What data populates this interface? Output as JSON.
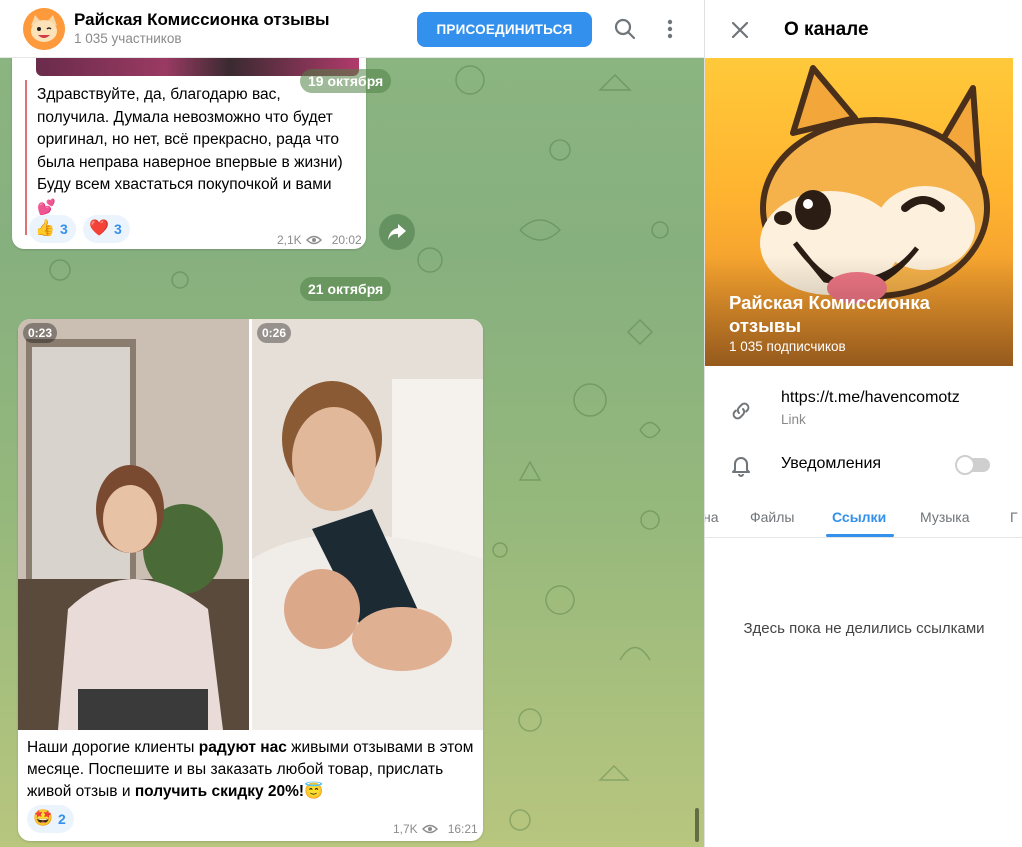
{
  "chat": {
    "title": "Райская Комиссионка отзывы",
    "subtitle": "1 035 участников",
    "join_label": "ПРИСОЕДИНИТЬСЯ"
  },
  "messages": [
    {
      "text_lines": [
        "Здравствуйте, да, благодарю вас,",
        "получила. Думала невозможно что будет",
        "оригинал, но нет, всё прекрасно, рада что",
        "была неправа наверное впервые в жизни)",
        "Буду всем хвастаться покупочкой и вами"
      ],
      "emoji": "💕",
      "reactions": [
        {
          "emoji": "👍",
          "count": "3"
        },
        {
          "emoji": "❤️",
          "count": "3"
        }
      ],
      "views": "2,1K",
      "time": "20:02"
    },
    {
      "videos": [
        {
          "duration": "0:23"
        },
        {
          "duration": "0:26"
        }
      ],
      "text_parts": [
        {
          "t": "Наши дорогие клиенты ",
          "b": false
        },
        {
          "t": "радуют нас",
          "b": true
        },
        {
          "t": " живыми отзывами в этом месяце. Поспешите и вы заказать любой товар, прислать живой отзыв и ",
          "b": false
        },
        {
          "t": "получить скидку 20%!",
          "b": true
        },
        {
          "t": "😇",
          "b": false
        }
      ],
      "reactions": [
        {
          "emoji": "🤩",
          "count": "2"
        }
      ],
      "views": "1,7K",
      "time": "16:21"
    }
  ],
  "dates": {
    "first": "19 октября",
    "second": "21 октября"
  },
  "info": {
    "title": "О канале",
    "channel_name": "Райская Комиссионка отзывы",
    "subscribers": "1 035 подписчиков",
    "link": "https://t.me/havencomotz",
    "link_caption": "Link",
    "notifications_label": "Уведомления",
    "notifications_on": false,
    "tabs": [
      {
        "label": "на",
        "active": false
      },
      {
        "label": "Файлы",
        "active": false
      },
      {
        "label": "Ссылки",
        "active": true
      },
      {
        "label": "Музыка",
        "active": false
      },
      {
        "label": "Г",
        "active": false
      }
    ],
    "empty_text": "Здесь пока не делились ссылками"
  },
  "colors": {
    "accent": "#3390ec",
    "chat_bg": "#8bb581",
    "cover_bg": "#ffb330"
  },
  "icons": [
    "search-icon",
    "more-vertical-icon",
    "close-icon",
    "link-icon",
    "bell-icon",
    "eye-icon",
    "share-icon"
  ]
}
